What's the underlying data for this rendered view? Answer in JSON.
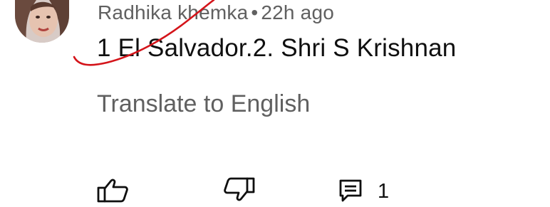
{
  "comment": {
    "author": "Radhika khemka",
    "separator": "•",
    "timestamp": "22h ago",
    "text": "1 El Salvador.2. Shri S Krishnan",
    "translate_label": "Translate to English",
    "reply_count": "1"
  },
  "icons": {
    "like": "thumbs-up-icon",
    "dislike": "thumbs-down-icon",
    "reply": "comment-icon"
  },
  "colors": {
    "annotation_stroke": "#d4141a",
    "secondary_text": "#606060",
    "primary_text": "#0f0f0f"
  }
}
